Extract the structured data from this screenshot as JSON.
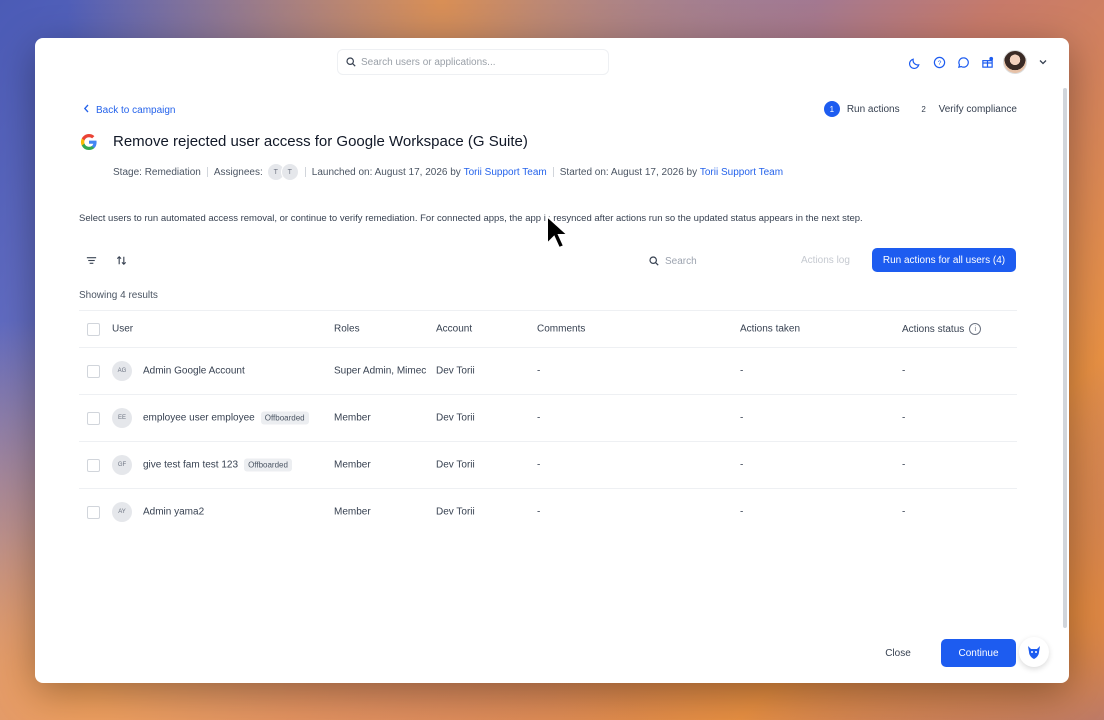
{
  "topbar": {
    "search_placeholder": "Search users or applications...",
    "icons": [
      "moon-icon",
      "help-icon",
      "chat-icon",
      "gift-icon",
      "avatar",
      "chevron-down-icon"
    ]
  },
  "header": {
    "back_label": "Back to campaign",
    "steps": [
      {
        "num": "1",
        "label": "Run actions",
        "active": true
      },
      {
        "num": "2",
        "label": "Verify compliance",
        "active": false
      }
    ],
    "title": "Remove rejected user access for Google Workspace (G Suite)",
    "stage": "Stage: Remediation",
    "assignees_label": "Assignees:",
    "assignees": [
      "T",
      "T"
    ],
    "launched_prefix": "Launched on: August 17, 2026 by",
    "launched_by": "Torii Support Team",
    "started_prefix": "Started on: August 17, 2026 by",
    "started_by": "Torii Support Team"
  },
  "description": "Select users to run automated access removal, or continue to verify remediation. For connected apps, the app is resynced after actions run so the updated status appears in the next step.",
  "toolbar": {
    "search_placeholder": "Search",
    "actions_log": "Actions log",
    "run_all": "Run actions for all users (4)"
  },
  "results_label": "Showing 4 results",
  "table": {
    "columns": {
      "user": "User",
      "roles": "Roles",
      "account": "Account",
      "comments": "Comments",
      "actions_taken": "Actions taken",
      "actions_status": "Actions status"
    },
    "rows": [
      {
        "initials": "AG",
        "name": "Admin Google Account",
        "badge": "",
        "roles": "Super Admin, Mimec",
        "account": "Dev Torii",
        "comments": "-",
        "actions_taken": "-",
        "actions_status": "-"
      },
      {
        "initials": "EE",
        "name": "employee user employee",
        "badge": "Offboarded",
        "roles": "Member",
        "account": "Dev Torii",
        "comments": "-",
        "actions_taken": "-",
        "actions_status": "-"
      },
      {
        "initials": "GF",
        "name": "give test fam test 123",
        "badge": "Offboarded",
        "roles": "Member",
        "account": "Dev Torii",
        "comments": "-",
        "actions_taken": "-",
        "actions_status": "-"
      },
      {
        "initials": "AY",
        "name": "Admin yama2",
        "badge": "",
        "roles": "Member",
        "account": "Dev Torii",
        "comments": "-",
        "actions_taken": "-",
        "actions_status": "-"
      }
    ]
  },
  "footer": {
    "close": "Close",
    "continue": "Continue"
  },
  "colors": {
    "accent": "#1d5cf0",
    "link": "#2563eb"
  }
}
